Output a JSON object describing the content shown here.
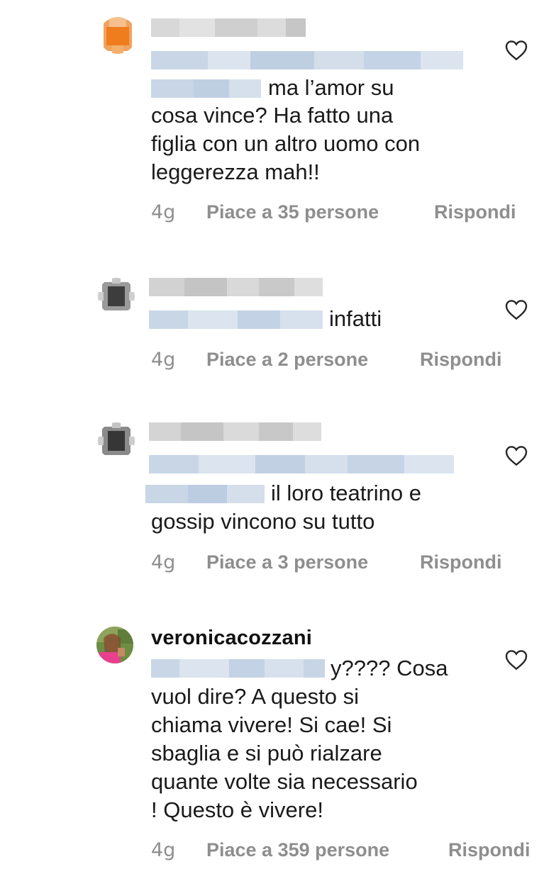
{
  "comments": [
    {
      "username": "",
      "mention_text": "",
      "text_lines": [
        "ma l’amor su",
        "cosa vince? Ha fatto una",
        "figlia con un altro uomo con",
        "leggerezza mah!!"
      ],
      "time": "4g",
      "likes": "Piace a 35 persone",
      "reply": "Rispondi",
      "like_icon": "heart-outline-icon"
    },
    {
      "username": "",
      "text_lines": [
        "infatti"
      ],
      "time": "4g",
      "likes": "Piace a 2 persone",
      "reply": "Rispondi",
      "like_icon": "heart-outline-icon"
    },
    {
      "username": "",
      "text_lines": [
        "il loro teatrino e",
        "gossip vincono su tutto"
      ],
      "time": "4g",
      "likes": "Piace a 3 persone",
      "reply": "Rispondi",
      "like_icon": "heart-outline-icon"
    },
    {
      "username": "veronicacozzani",
      "text_lines": [
        "y???? Cosa",
        "vuol dire? A questo si",
        "chiama vivere! Si cae! Si",
        "sbaglia e si può rialzare",
        "quante volte sia necessario",
        "! Questo è vivere!"
      ],
      "time": "4g",
      "likes": "Piace a 359 persone",
      "reply": "Rispondi",
      "like_icon": "heart-outline-icon"
    }
  ],
  "colors": {
    "meta_gray": "#8e8e8e",
    "blur_blue": "#c9d6e6",
    "blur_gray": "#d6d6d6"
  }
}
